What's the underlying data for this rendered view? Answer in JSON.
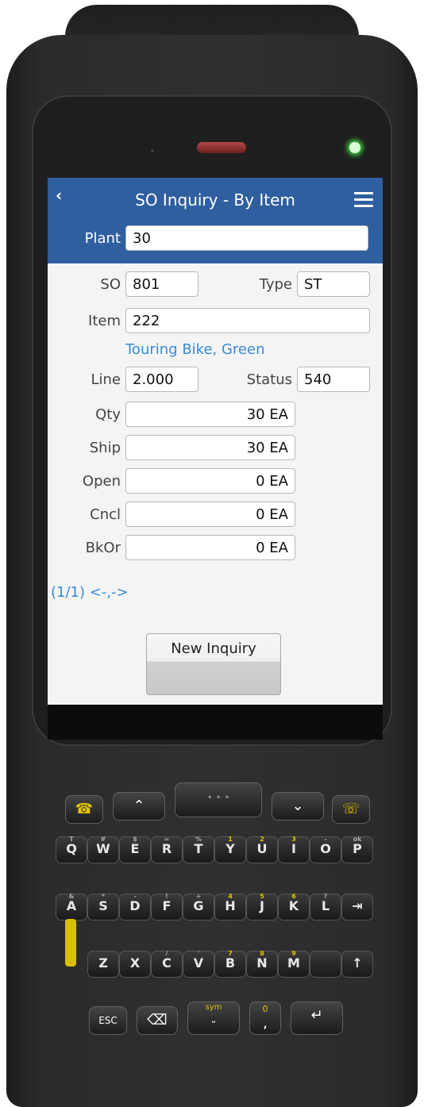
{
  "header": {
    "title": "SO Inquiry - By Item",
    "back_glyph": "‹",
    "plant_label": "Plant",
    "plant_value": "30"
  },
  "form": {
    "so_label": "SO",
    "so_value": "801",
    "type_label": "Type",
    "type_value": "ST",
    "item_label": "Item",
    "item_value": "222",
    "item_description": "Touring Bike, Green",
    "line_label": "Line",
    "line_value": "2.000",
    "status_label": "Status",
    "status_value": "540",
    "qty_label": "Qty",
    "qty_value": "30 EA",
    "ship_label": "Ship",
    "ship_value": "30 EA",
    "open_label": "Open",
    "open_value": "0 EA",
    "cncl_label": "Cncl",
    "cncl_value": "0 EA",
    "bkor_label": "BkOr",
    "bkor_value": "0 EA"
  },
  "pager": "(1/1) <-,->",
  "new_inquiry_button": "New Inquiry",
  "keyboard": {
    "row1": [
      [
        "T",
        "Q"
      ],
      [
        "#",
        "W"
      ],
      [
        "$",
        "E"
      ],
      [
        "=",
        "R"
      ],
      [
        "%",
        "T"
      ],
      [
        "1",
        "Y"
      ],
      [
        "2",
        "U"
      ],
      [
        "3",
        "I"
      ],
      [
        "-",
        "O"
      ],
      [
        "ok",
        "P"
      ]
    ],
    "row2": [
      [
        "&",
        "A"
      ],
      [
        "*",
        "S"
      ],
      [
        "-",
        "D"
      ],
      [
        "!",
        "F"
      ],
      [
        "+",
        "G"
      ],
      [
        "4",
        "H"
      ],
      [
        "5",
        "J"
      ],
      [
        "6",
        "K"
      ],
      [
        "?",
        "L"
      ],
      [
        "",
        "⇥"
      ]
    ],
    "row3": [
      [
        "",
        ""
      ],
      [
        "",
        "Z"
      ],
      [
        "",
        "X"
      ],
      [
        "/",
        "C"
      ],
      [
        "'",
        "V"
      ],
      [
        "7",
        "B"
      ],
      [
        "8",
        "N"
      ],
      [
        "9",
        "M"
      ],
      [
        "",
        ""
      ],
      [
        "",
        "↑"
      ]
    ],
    "row4_esc": "ESC",
    "row4_sym": "sym",
    "row4_comma": ",",
    "row4_zero": "0"
  },
  "colors": {
    "header": "#2f5f9f",
    "link": "#3a8ad6",
    "led": "#3fcf3f"
  }
}
